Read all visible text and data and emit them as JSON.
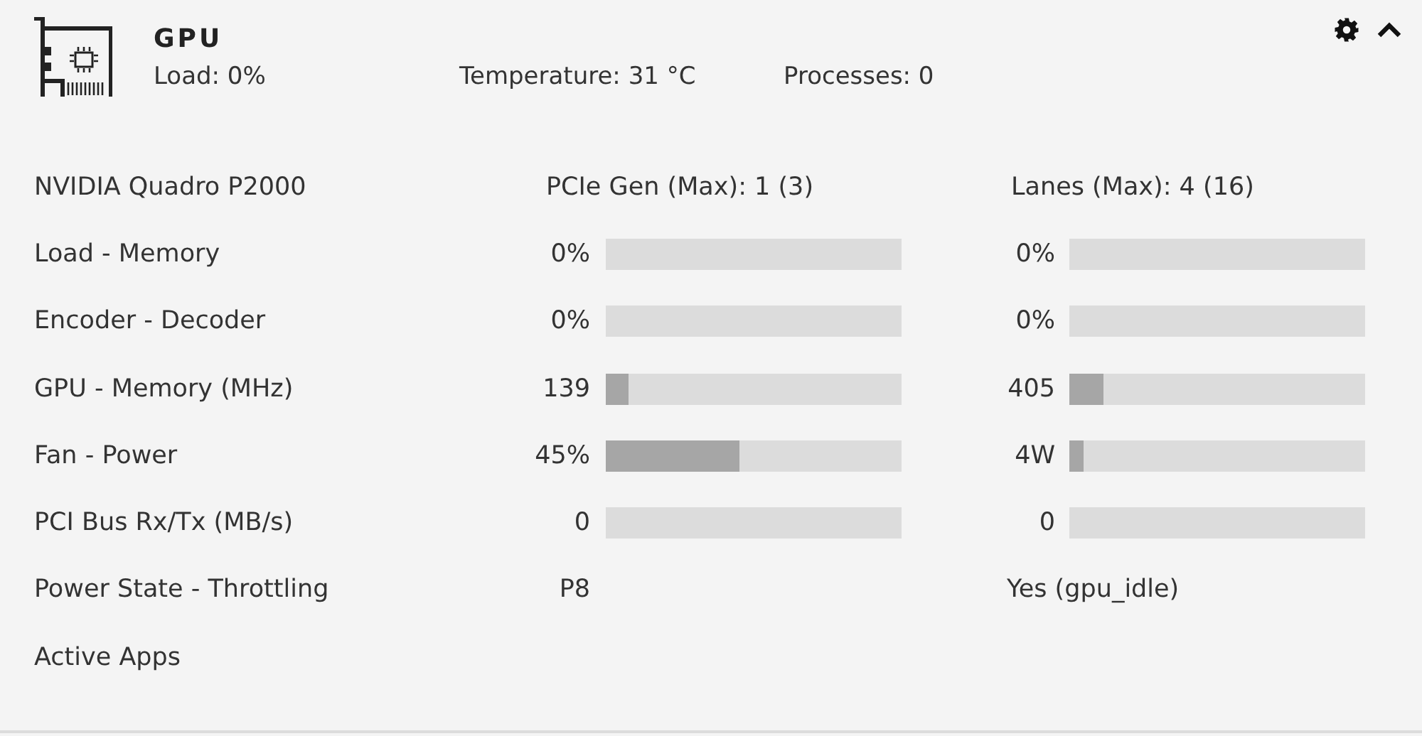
{
  "header": {
    "title": "GPU",
    "load": "Load: 0%",
    "temperature": "Temperature: 31 °C",
    "processes": "Processes: 0",
    "expanded": true
  },
  "rows": [
    {
      "kind": "info",
      "label": "NVIDIA Quadro P2000",
      "col_1": "PCIe Gen (Max): 1 (3)",
      "col_2": "Lanes (Max): 4 (16)"
    },
    {
      "kind": "bars",
      "label": "Load - Memory",
      "meters": [
        {
          "value": "0%"
        },
        {
          "value": "0%"
        }
      ]
    },
    {
      "kind": "bars",
      "label": "Encoder - Decoder",
      "meters": [
        {
          "value": "0%"
        },
        {
          "value": "0%"
        }
      ]
    },
    {
      "kind": "bars",
      "label": "GPU - Memory (MHz)",
      "meters": [
        {
          "value": "139",
          "level": 0.077
        },
        {
          "value": "405",
          "level": 0.115
        }
      ]
    },
    {
      "kind": "bars",
      "label": "Fan - Power",
      "meters": [
        {
          "value": "45%",
          "level": 0.45
        },
        {
          "value": "4W",
          "level": 0.05
        }
      ]
    },
    {
      "kind": "bars",
      "label": "PCI Bus Rx/Tx (MB/s)",
      "meters": [
        {
          "value": "0"
        },
        {
          "value": "0"
        }
      ]
    },
    {
      "kind": "text",
      "label": "Power State - Throttling",
      "value_1": "P8",
      "value_2": "Yes (gpu_idle)"
    },
    {
      "kind": "label",
      "label": "Active Apps"
    }
  ]
}
